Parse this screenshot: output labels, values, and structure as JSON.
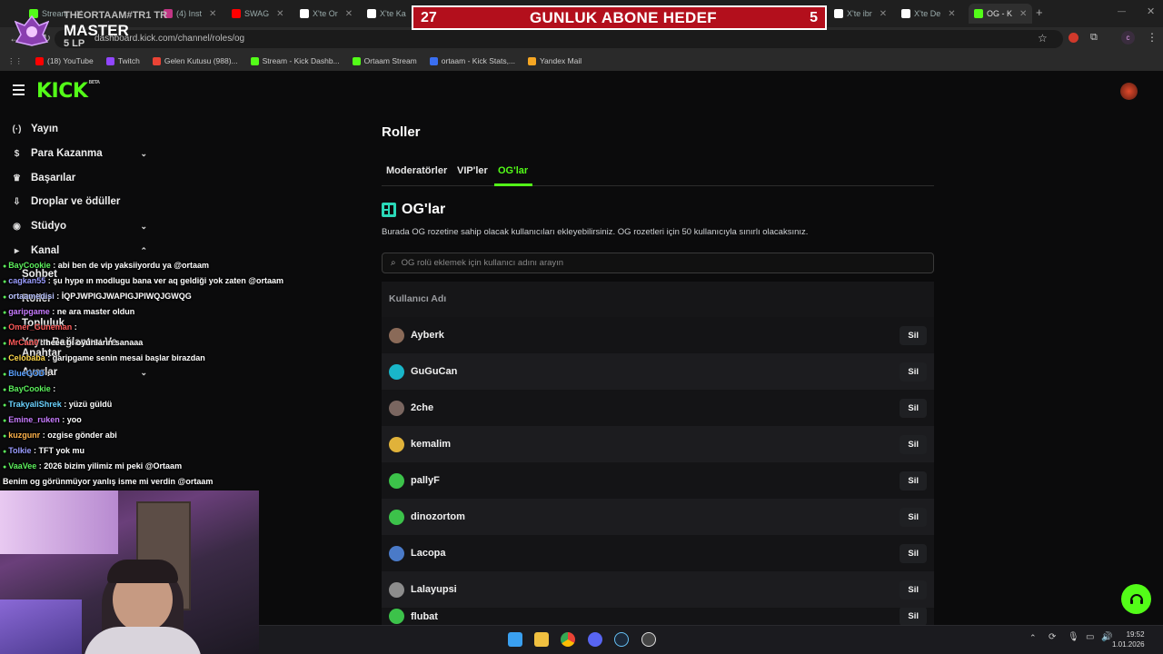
{
  "browser": {
    "tabs": [
      {
        "label": "Stream",
        "color": "#53fc18"
      },
      {
        "label": "(4) Inst",
        "color": "#c13584"
      },
      {
        "label": "SWAG",
        "color": "#ff0000"
      },
      {
        "label": "X'te Or",
        "color": "#ffffff"
      },
      {
        "label": "X'te Ka",
        "color": "#ffffff"
      },
      {
        "label": "X'te ibr",
        "color": "#ffffff"
      },
      {
        "label": "X'te De",
        "color": "#ffffff"
      },
      {
        "label": "OG - K",
        "color": "#53fc18"
      }
    ],
    "url": "dashboard.kick.com/channel/roles/og",
    "bookmarks": [
      {
        "label": "(18) YouTube",
        "color": "#ff0000"
      },
      {
        "label": "Twitch",
        "color": "#9146ff"
      },
      {
        "label": "Gelen Kutusu (988)...",
        "color": "#ea4335"
      },
      {
        "label": "Stream - Kick Dashb...",
        "color": "#53fc18"
      },
      {
        "label": "Ortaam Stream",
        "color": "#53fc18"
      },
      {
        "label": "ortaam - Kick Stats,...",
        "color": "#3a6ff2"
      },
      {
        "label": "Yandex Mail",
        "color": "#f5a623"
      }
    ]
  },
  "overlay": {
    "goal_current": "27",
    "goal_title": "GUNLUK ABONE HEDEF",
    "goal_target": "5",
    "rank_name": "THEORTAAM#TR1 TR",
    "rank_tier": "MASTER",
    "rank_lp": "5 LP"
  },
  "kick": {
    "logo": "KICK",
    "logo_badge": "BETA"
  },
  "sidebar": {
    "items": [
      {
        "label": "Yayın",
        "icon": "(·)",
        "chev": ""
      },
      {
        "label": "Para Kazanma",
        "icon": "$",
        "chev": "⌄"
      },
      {
        "label": "Başarılar",
        "icon": "♛",
        "chev": ""
      },
      {
        "label": "Droplar ve ödüller",
        "icon": "⇩",
        "chev": ""
      },
      {
        "label": "Stüdyo",
        "icon": "◉",
        "chev": "⌄"
      },
      {
        "label": "Kanal",
        "icon": "▸",
        "chev": "⌃"
      },
      {
        "label": "Sohbet",
        "icon": "",
        "chev": ""
      },
      {
        "label": "Roller",
        "icon": "",
        "chev": ""
      },
      {
        "label": "Topluluk",
        "icon": "",
        "chev": ""
      },
      {
        "label": "Yayın Bağlantısı Ve Anahtar",
        "icon": "",
        "chev": ""
      },
      {
        "label": "Ayarlar",
        "icon": "",
        "chev": "⌄"
      }
    ]
  },
  "main": {
    "title": "Roller",
    "tabs": [
      "Moderatörler",
      "VIP'ler",
      "OG'lar"
    ],
    "section_title": "OG'lar",
    "description": "Burada OG rozetine sahip olacak kullanıcıları ekleyebilirsiniz. OG rozetleri için 50 kullanıcıyla sınırlı olacaksınız.",
    "search_placeholder": "OG rolü eklemek için kullanıcı adını arayın",
    "table_header": "Kullanıcı Adı",
    "remove_label": "Sil",
    "users": [
      {
        "name": "Ayberk",
        "color": "#8a6a58"
      },
      {
        "name": "GuGuCan",
        "color": "#19b6c9"
      },
      {
        "name": "2che",
        "color": "#7a6660"
      },
      {
        "name": "kemalim",
        "color": "#e0b23a"
      },
      {
        "name": "pallyF",
        "color": "#3cc24a"
      },
      {
        "name": "dinozortom",
        "color": "#3cc24a"
      },
      {
        "name": "Lacopa",
        "color": "#4a7ac8"
      },
      {
        "name": "Lalayupsi",
        "color": "#8c8c8c"
      },
      {
        "name": "flubat",
        "color": "#3cc24a"
      }
    ]
  },
  "chat": [
    {
      "user": "BayCookie",
      "color": "#5cf05c",
      "text": "abi ben de vip yaksiiyordu ya @ortaam"
    },
    {
      "user": "cagkan55",
      "color": "#9a9cff",
      "text": "şu hype ın modlugu bana ver aq geldiği yok zaten @ortaam"
    },
    {
      "user": "ortaamedisi",
      "color": "#b9c3ff",
      "text": "İQPJWPIGJWAPIGJPIWQJGWQG"
    },
    {
      "user": "garipgame",
      "color": "#c77bff",
      "text": "ne ara master oldun"
    },
    {
      "user": "Omer_Guneman",
      "color": "#ff5a5a",
      "text": ""
    },
    {
      "user": "MrCan0",
      "color": "#ff5a5a",
      "text": "heee bi oyunların sanaaa"
    },
    {
      "user": "Celobaba",
      "color": "#ffd84a",
      "text": "garipgame senin mesai başlar birazdan"
    },
    {
      "user": "BlueGOD",
      "color": "#5aa0ff",
      "text": ""
    },
    {
      "user": "BayCookie",
      "color": "#5cf05c",
      "text": ""
    },
    {
      "user": "TrakyaliShrek",
      "color": "#6ad2ff",
      "text": "yüzü güldü"
    },
    {
      "user": "Emine_ruken",
      "color": "#c77bff",
      "text": "yoo"
    },
    {
      "user": "kuzgunr",
      "color": "#ffb24a",
      "text": "ozgise gönder abi"
    },
    {
      "user": "Tolkie",
      "color": "#9a9cff",
      "text": "TFT yok mu"
    },
    {
      "user": "VaaVee",
      "color": "#5cf05c",
      "text": "2026 bizim yilimiz mi peki @Ortaam"
    },
    {
      "user": "",
      "color": "#ffffff",
      "text": "Benim og görünmüyor yanlış isme mi verdin @ortaam"
    }
  ],
  "system": {
    "time": "19:52",
    "date": "1.01.2026"
  }
}
